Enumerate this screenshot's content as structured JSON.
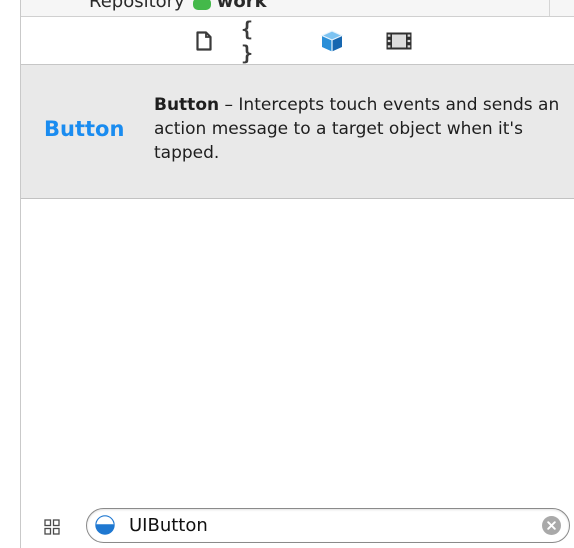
{
  "repository": {
    "label": "Repository",
    "branch": "work"
  },
  "library": {
    "tabs": [
      {
        "name": "file-template-library",
        "icon": "file-icon"
      },
      {
        "name": "code-snippet-library",
        "icon": "braces-icon",
        "glyph": "{ }"
      },
      {
        "name": "object-library",
        "icon": "cube-icon",
        "selected": true
      },
      {
        "name": "media-library",
        "icon": "film-icon"
      }
    ]
  },
  "description": {
    "preview": "Button",
    "title": "Button",
    "text": " – Intercepts touch events and sends an action message to a target object when it's tapped."
  },
  "filter": {
    "value": "UIButton"
  },
  "colors": {
    "accent": "#1a8cf0",
    "panel_bg": "#e9e9e9",
    "repo_status": "#44b94a",
    "object_icon": "#2a8fd8"
  }
}
